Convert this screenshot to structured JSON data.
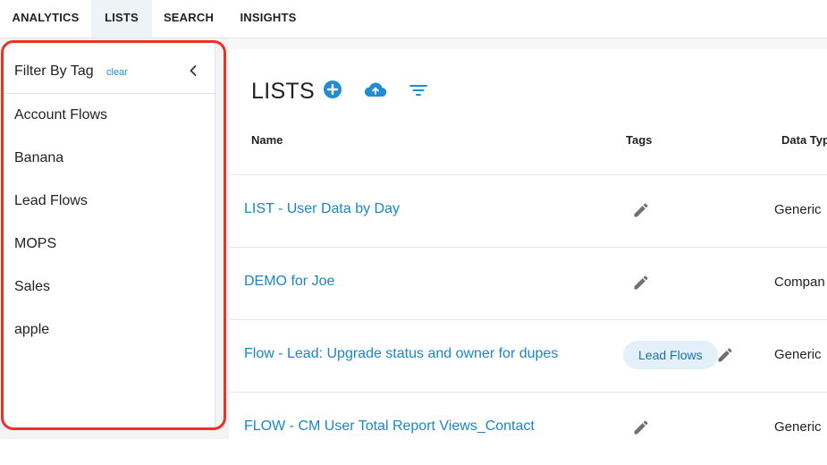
{
  "nav": {
    "tabs": [
      {
        "label": "ANALYTICS"
      },
      {
        "label": "LISTS"
      },
      {
        "label": "SEARCH"
      },
      {
        "label": "INSIGHTS"
      }
    ],
    "active_tab": "LISTS"
  },
  "filter": {
    "title": "Filter By Tag",
    "clear_label": "clear",
    "tags": [
      "Account Flows",
      "Banana",
      "Lead Flows",
      "MOPS",
      "Sales",
      "apple"
    ]
  },
  "main": {
    "title": "LISTS",
    "columns": {
      "name": "Name",
      "tags": "Tags",
      "data_type": "Data Typ"
    },
    "rows": [
      {
        "name": "LIST - User Data by Day",
        "tag": "",
        "data_type": "Generic"
      },
      {
        "name": "DEMO for Joe",
        "tag": "",
        "data_type": "Compan"
      },
      {
        "name": "Flow - Lead: Upgrade status and owner for dupes",
        "tag": "Lead Flows",
        "data_type": "Generic"
      },
      {
        "name": "FLOW - CM User Total Report Views_Contact",
        "tag": "",
        "data_type": "Generic"
      }
    ]
  },
  "colors": {
    "accent": "#1a86c8",
    "icon_blue": "#1f8dd0",
    "highlight_outline": "#e8332a",
    "chip_bg": "#e3f0fa"
  },
  "icons": {
    "add": "plus-circle-icon",
    "upload": "cloud-upload-icon",
    "filter": "filter-icon",
    "collapse": "chevron-left-icon",
    "edit": "pencil-icon"
  }
}
